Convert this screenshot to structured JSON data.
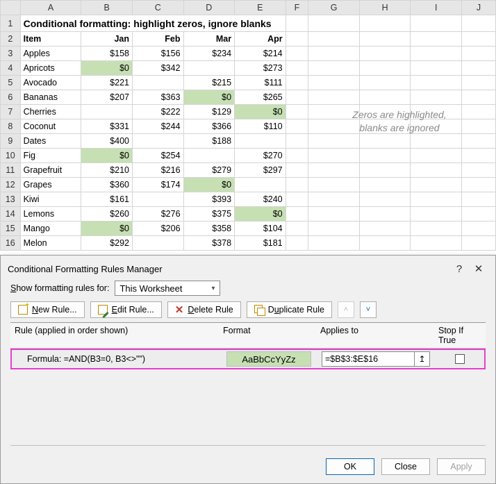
{
  "columns": [
    "A",
    "B",
    "C",
    "D",
    "E",
    "F",
    "G",
    "H",
    "I",
    "J"
  ],
  "title": "Conditional formatting: highlight zeros, ignore blanks",
  "headers": {
    "item": "Item",
    "months": [
      "Jan",
      "Feb",
      "Mar",
      "Apr"
    ]
  },
  "rows": [
    {
      "n": 3,
      "item": "Apples",
      "vals": [
        "$158",
        "$156",
        "$234",
        "$214"
      ],
      "hl": [
        false,
        false,
        false,
        false
      ]
    },
    {
      "n": 4,
      "item": "Apricots",
      "vals": [
        "$0",
        "$342",
        "",
        "$273"
      ],
      "hl": [
        true,
        false,
        false,
        false
      ]
    },
    {
      "n": 5,
      "item": "Avocado",
      "vals": [
        "$221",
        "",
        "$215",
        "$111"
      ],
      "hl": [
        false,
        false,
        false,
        false
      ]
    },
    {
      "n": 6,
      "item": "Bananas",
      "vals": [
        "$207",
        "$363",
        "$0",
        "$265"
      ],
      "hl": [
        false,
        false,
        true,
        false
      ]
    },
    {
      "n": 7,
      "item": "Cherries",
      "vals": [
        "",
        "$222",
        "$129",
        "$0"
      ],
      "hl": [
        false,
        false,
        false,
        true
      ]
    },
    {
      "n": 8,
      "item": "Coconut",
      "vals": [
        "$331",
        "$244",
        "$366",
        "$110"
      ],
      "hl": [
        false,
        false,
        false,
        false
      ]
    },
    {
      "n": 9,
      "item": "Dates",
      "vals": [
        "$400",
        "",
        "$188",
        ""
      ],
      "hl": [
        false,
        false,
        false,
        false
      ]
    },
    {
      "n": 10,
      "item": "Fig",
      "vals": [
        "$0",
        "$254",
        "",
        "$270"
      ],
      "hl": [
        true,
        false,
        false,
        false
      ]
    },
    {
      "n": 11,
      "item": "Grapefruit",
      "vals": [
        "$210",
        "$216",
        "$279",
        "$297"
      ],
      "hl": [
        false,
        false,
        false,
        false
      ]
    },
    {
      "n": 12,
      "item": "Grapes",
      "vals": [
        "$360",
        "$174",
        "$0",
        ""
      ],
      "hl": [
        false,
        false,
        true,
        false
      ]
    },
    {
      "n": 13,
      "item": "Kiwi",
      "vals": [
        "$161",
        "",
        "$393",
        "$240"
      ],
      "hl": [
        false,
        false,
        false,
        false
      ]
    },
    {
      "n": 14,
      "item": "Lemons",
      "vals": [
        "$260",
        "$276",
        "$375",
        "$0"
      ],
      "hl": [
        false,
        false,
        false,
        true
      ]
    },
    {
      "n": 15,
      "item": "Mango",
      "vals": [
        "$0",
        "$206",
        "$358",
        "$104"
      ],
      "hl": [
        true,
        false,
        false,
        false
      ]
    },
    {
      "n": 16,
      "item": "Melon",
      "vals": [
        "$292",
        "",
        "$378",
        "$181"
      ],
      "hl": [
        false,
        false,
        false,
        false
      ]
    }
  ],
  "note_line1": "Zeros are highlighted,",
  "note_line2": "blanks are ignored",
  "dialog": {
    "title": "Conditional Formatting Rules Manager",
    "help_icon": "?",
    "close_icon": "✕",
    "show_label_pre": "S",
    "show_label_post": "how formatting rules for:",
    "scope": "This Worksheet",
    "buttons": {
      "new": "New Rule...",
      "edit": "Edit Rule...",
      "delete": "Delete Rule",
      "duplicate": "Duplicate Rule",
      "up": "˄",
      "down": "˅"
    },
    "headers": {
      "rule": "Rule (applied in order shown)",
      "format": "Format",
      "applies": "Applies to",
      "stop": "Stop If True"
    },
    "rule": {
      "text": "Formula: =AND(B3=0, B3<>\"\")",
      "sample": "AaBbCcYyZz",
      "applies": "=$B$3:$E$16",
      "picker": "↥"
    },
    "footer": {
      "ok": "OK",
      "close": "Close",
      "apply": "Apply"
    }
  }
}
